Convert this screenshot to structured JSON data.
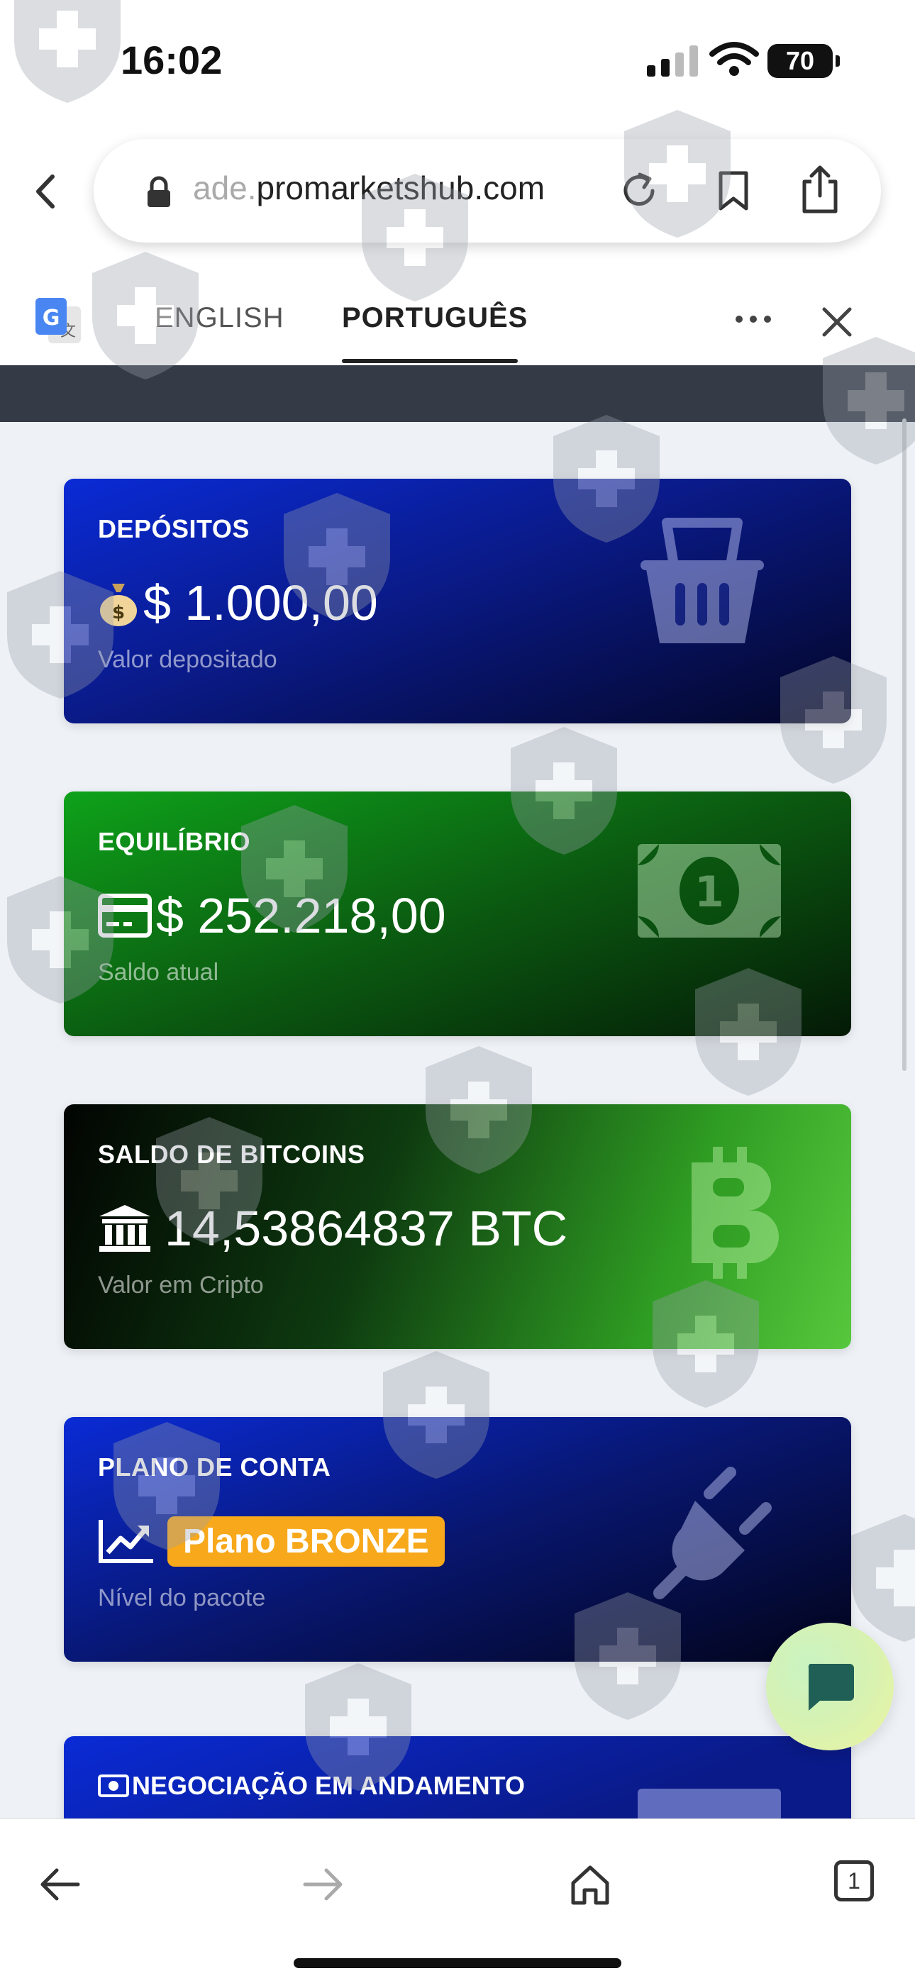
{
  "status_bar": {
    "time": "16:02",
    "battery": "70"
  },
  "browser": {
    "url_prefix": "ade.",
    "url_domain": "promarketshub.com"
  },
  "translate_bar": {
    "lang_english": "ENGLISH",
    "lang_portuguese": "PORTUGUÊS",
    "active": "PORTUGUÊS"
  },
  "cards": {
    "deposits": {
      "title": "DEPÓSITOS",
      "value": "$ 1.000,00",
      "sub": "Valor depositado",
      "icon": "basket-icon",
      "accent": "#0a2bd6"
    },
    "balance": {
      "title": "EQUILÍBRIO",
      "value": "$ 252.218,00",
      "sub": "Saldo atual",
      "icon": "money-bill-icon",
      "accent": "#0ea21a"
    },
    "bitcoin": {
      "title": "SALDO DE BITCOINS",
      "value": "14,53864837 BTC",
      "sub": "Valor em Cripto",
      "icon": "bitcoin-icon",
      "accent": "#57c83d"
    },
    "plan": {
      "title": "PLANO DE CONTA",
      "badge": "Plano BRONZE",
      "sub": "Nível do pacote",
      "icon": "plug-icon",
      "badge_color": "#f7a81b"
    },
    "trading": {
      "title": "NEGOCIAÇÃO EM ANDAMENTO"
    }
  },
  "bottom_nav": {
    "tabs_count": "1"
  }
}
